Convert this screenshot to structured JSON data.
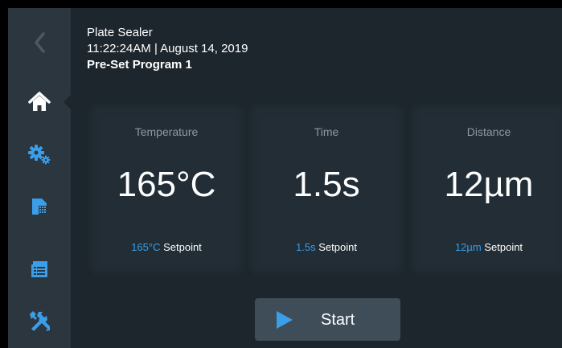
{
  "colors": {
    "background": "#1d262d",
    "sidebar": "#2b363f",
    "card": "#222d35",
    "accent": "#3b9ee8",
    "button": "#3f4d58",
    "label": "#8e9aa3"
  },
  "sidebar": {
    "items": [
      {
        "icon": "back-chevron-icon",
        "active": false,
        "enabled": false
      },
      {
        "icon": "home-icon",
        "active": true
      },
      {
        "icon": "settings-gears-icon",
        "active": false
      },
      {
        "icon": "plate-icon",
        "active": false
      },
      {
        "icon": "log-list-icon",
        "active": false
      },
      {
        "icon": "tools-icon",
        "active": false
      }
    ]
  },
  "header": {
    "device": "Plate Sealer",
    "datetime": "11:22:24AM | August 14, 2019",
    "program": "Pre-Set Program 1"
  },
  "cards": [
    {
      "label": "Temperature",
      "value": "165°C",
      "setpoint_value": "165°C",
      "setpoint_word": "Setpoint"
    },
    {
      "label": "Time",
      "value": "1.5s",
      "setpoint_value": "1.5s",
      "setpoint_word": "Setpoint"
    },
    {
      "label": "Distance",
      "value": "12µm",
      "setpoint_value": "12µm",
      "setpoint_word": "Setpoint"
    }
  ],
  "start_button": {
    "label": "Start",
    "icon": "play-icon"
  }
}
